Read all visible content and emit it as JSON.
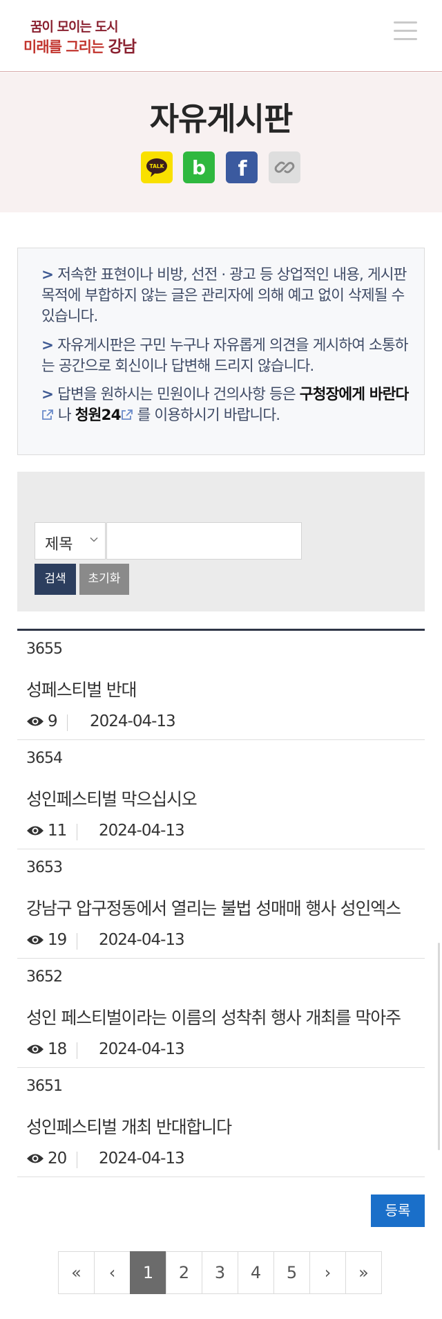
{
  "header": {
    "logo_line1": "꿈이 모이는 도시",
    "logo_line2_a": "미래를 그리는 ",
    "logo_line2_b": "강남",
    "menu_icon": "hamburger-icon"
  },
  "page": {
    "title": "자유게시판"
  },
  "share": {
    "icons": [
      "kakaotalk-icon",
      "band-icon",
      "facebook-icon",
      "link-icon"
    ],
    "kakao_label": "TALK",
    "band_label": "b",
    "facebook_label": "f",
    "colors": {
      "kakao": "#f9e000",
      "band": "#2fb83f",
      "facebook": "#3b5a9f",
      "link": "#dedede"
    }
  },
  "notice": {
    "arrow": ">",
    "item1": "저속한 표현이나 비방, 선전 · 광고 등 상업적인 내용, 게시판 목적에 부합하지 않는 글은 관리자에 의해 예고 없이 삭제될 수 있습니다.",
    "item2": "자유게시판은 구민 누구나 자유롭게 의견을 게시하여 소통하는 공간으로 회신이나 답변해 드리지 않습니다.",
    "item3_pre": "답변을 원하시는 민원이나 건의사항 등은 ",
    "item3_link1": "구청장에게 바란다",
    "item3_mid": " 나 ",
    "item3_link2": "청원24",
    "item3_post": " 를 이용하시기 바랍니다."
  },
  "search": {
    "select_value": "제목",
    "input_value": "",
    "search_label": "검색",
    "reset_label": "초기화"
  },
  "posts": [
    {
      "number": "3655",
      "title": "성페스티벌 반대",
      "views": "9",
      "date": "2024-04-13"
    },
    {
      "number": "3654",
      "title": "성인페스티벌 막으십시오",
      "views": "11",
      "date": "2024-04-13"
    },
    {
      "number": "3653",
      "title": "강남구 압구정동에서 열리는 불법 성매매 행사 성인엑스",
      "views": "19",
      "date": "2024-04-13"
    },
    {
      "number": "3652",
      "title": "성인 페스티벌이라는 이름의 성착취 행사 개최를 막아주",
      "views": "18",
      "date": "2024-04-13"
    },
    {
      "number": "3651",
      "title": "성인페스티벌 개최 반대합니다",
      "views": "20",
      "date": "2024-04-13"
    }
  ],
  "actions": {
    "register_label": "등록"
  },
  "pagination": {
    "first": "«",
    "prev": "‹",
    "pages": [
      "1",
      "2",
      "3",
      "4",
      "5"
    ],
    "current": "1",
    "next": "›",
    "last": "»"
  }
}
